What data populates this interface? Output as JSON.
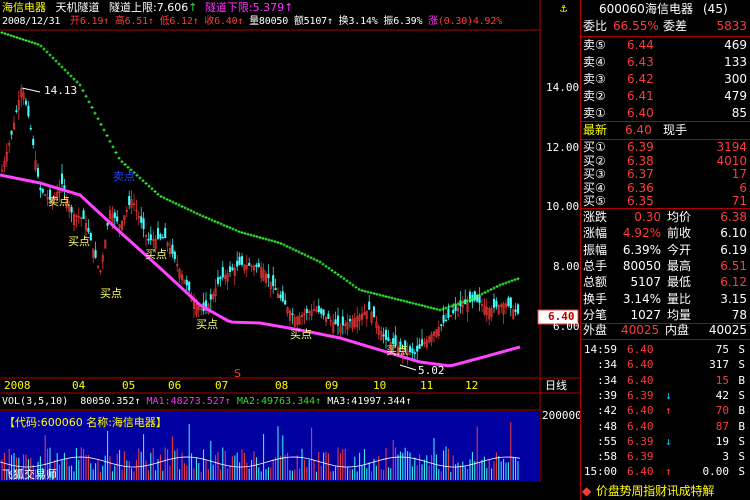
{
  "header": {
    "stock_name": "海信电器",
    "indicator_name": "天机隧道",
    "upper_label": "隧道上限:",
    "upper_value": "7.606",
    "lower_label": "隧道下限:",
    "lower_value": "5.379",
    "date": "2008/12/31",
    "open_label": "开",
    "open": "6.19",
    "high_label": "高",
    "high": "6.51",
    "low_label": "低",
    "low": "6.12",
    "close_label": "收",
    "close": "6.40",
    "volume_label": "量",
    "volume": "80050",
    "amount_label": "额",
    "amount": "5107",
    "turnover_label": "换",
    "turnover": "3.14%",
    "amplitude_label": "振",
    "amplitude": "6.39%",
    "change_label": "涨",
    "change": "(0.30)",
    "change_pct": "4.92%"
  },
  "main_chart": {
    "y_ticks": [
      "14.00",
      "12.00",
      "10.00",
      "8.00",
      "6.00"
    ],
    "current_price_tag": "6.40",
    "high_annotation": "14.13",
    "low_annotation": "5.02",
    "x_ticks": [
      "2008",
      "04",
      "05",
      "06",
      "07",
      "08",
      "09",
      "10",
      "11",
      "12"
    ],
    "period_button": "日线",
    "signal_buy": "买点",
    "signal_sell": "卖点",
    "signal_marker": "S"
  },
  "volume_panel": {
    "title": "VOL(3,5,10)",
    "vol_value": "80050.352",
    "ma1_label": "MA1:",
    "ma1": "48273.527",
    "ma2_label": "MA2:",
    "ma2": "49763.344",
    "ma3_label": "MA3:",
    "ma3": "41997.344",
    "y_tick": "200000",
    "info_code_label": "【代码:600060 名称:海信电器】"
  },
  "footer": {
    "brand": "飞狐交易师",
    "nav": "价 盘 势 周 指 财 讯 成 特 解"
  },
  "panel": {
    "code": "600060",
    "name": "海信电器",
    "rank": "(45)",
    "weibi_label": "委比",
    "weibi": "66.55%",
    "weicha_label": "委差",
    "weicha": "5833",
    "sells": [
      {
        "label": "卖⑤",
        "price": "6.44",
        "vol": "469"
      },
      {
        "label": "卖④",
        "price": "6.43",
        "vol": "133"
      },
      {
        "label": "卖③",
        "price": "6.42",
        "vol": "300"
      },
      {
        "label": "卖②",
        "price": "6.41",
        "vol": "479"
      },
      {
        "label": "卖①",
        "price": "6.40",
        "vol": "85"
      }
    ],
    "latest_label": "最新",
    "latest": "6.40",
    "xianshou_label": "现手",
    "xianshou": "",
    "buys": [
      {
        "label": "买①",
        "price": "6.39",
        "vol": "3194"
      },
      {
        "label": "买②",
        "price": "6.38",
        "vol": "4010"
      },
      {
        "label": "买③",
        "price": "6.37",
        "vol": "17"
      },
      {
        "label": "买④",
        "price": "6.36",
        "vol": "6"
      },
      {
        "label": "买⑤",
        "price": "6.35",
        "vol": "71"
      }
    ],
    "stats": [
      {
        "l1": "涨跌",
        "v1": "0.30",
        "l2": "均价",
        "v2": "6.38"
      },
      {
        "l1": "涨幅",
        "v1": "4.92%",
        "l2": "前收",
        "v2": "6.10"
      },
      {
        "l1": "振幅",
        "v1": "6.39%",
        "l2": "今开",
        "v2": "6.19"
      },
      {
        "l1": "总手",
        "v1": "80050",
        "l2": "最高",
        "v2": "6.51"
      },
      {
        "l1": "总额",
        "v1": "5107",
        "l2": "最低",
        "v2": "6.12"
      },
      {
        "l1": "换手",
        "v1": "3.14%",
        "l2": "量比",
        "v2": "3.15"
      },
      {
        "l1": "分笔",
        "v1": "1027",
        "l2": "均量",
        "v2": "78"
      }
    ],
    "waipan_label": "外盘",
    "waipan": "40025",
    "neipan_label": "内盘",
    "neipan": "40025",
    "ticks": [
      {
        "time": "14:59",
        "price": "6.40",
        "arrow": "",
        "vol": "75",
        "bs": "S"
      },
      {
        "time": ":34",
        "price": "6.40",
        "arrow": "",
        "vol": "317",
        "bs": "S"
      },
      {
        "time": ":34",
        "price": "6.40",
        "arrow": "",
        "vol": "15",
        "bs": "B"
      },
      {
        "time": ":39",
        "price": "6.39",
        "arrow": "↓",
        "vol": "42",
        "bs": "S"
      },
      {
        "time": ":42",
        "price": "6.40",
        "arrow": "↑",
        "vol": "70",
        "bs": "B"
      },
      {
        "time": ":48",
        "price": "6.40",
        "arrow": "",
        "vol": "87",
        "bs": "B"
      },
      {
        "time": ":55",
        "price": "6.39",
        "arrow": "↓",
        "vol": "19",
        "bs": "S"
      },
      {
        "time": ":58",
        "price": "6.39",
        "arrow": "",
        "vol": "3",
        "bs": "S"
      },
      {
        "time": "15:00",
        "price": "6.40",
        "arrow": "↑",
        "vol": "0.00",
        "bs": "S"
      }
    ]
  }
}
